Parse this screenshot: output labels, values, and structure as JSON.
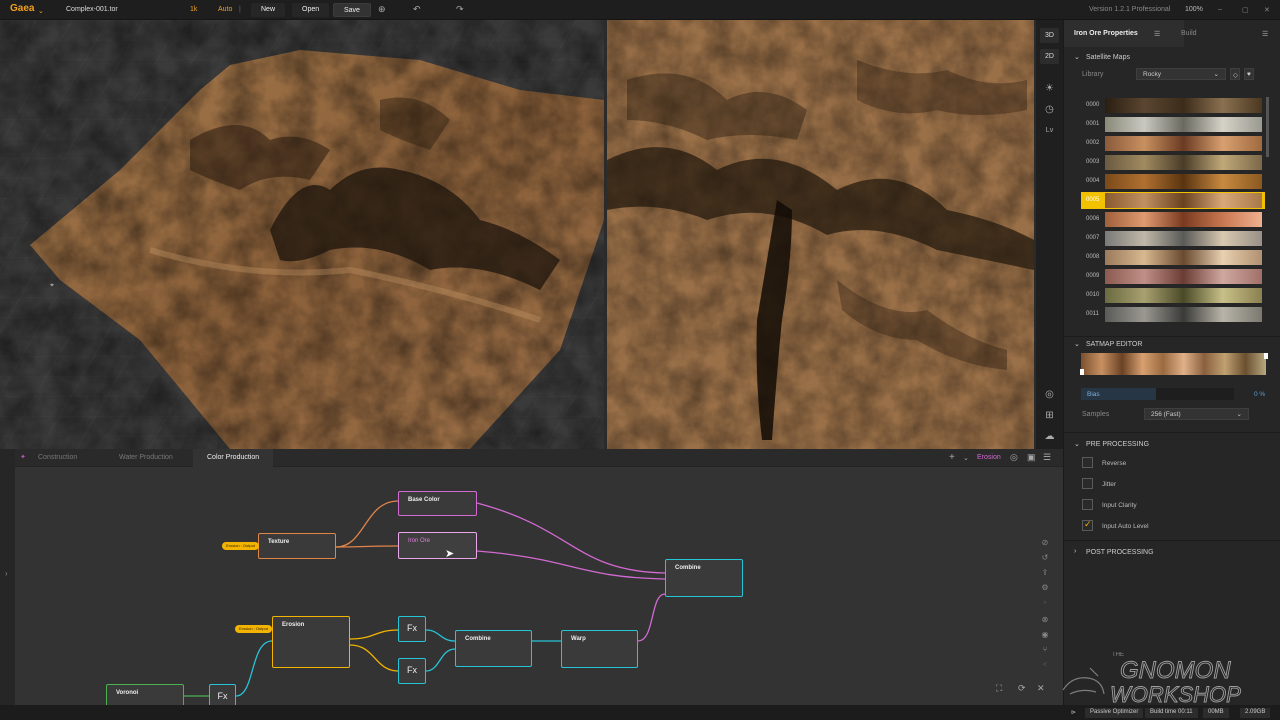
{
  "app": {
    "logo": "Gaea",
    "file_name": "Complex-001.tor",
    "resolution": "1k",
    "auto": "Auto",
    "new_label": "New",
    "open_label": "Open",
    "save_label": "Save",
    "version": "Version 1.2.1 Professional",
    "zoom": "100%"
  },
  "view_toolbar": {
    "btn_3d": "3D",
    "btn_2d": "2D",
    "lv": "Lv"
  },
  "right_panel": {
    "tab_properties": "Iron Ore Properties",
    "tab_build": "Build",
    "section_satmaps": "Satellite Maps",
    "library_label": "Library",
    "library_value": "Rocky",
    "swatches": [
      {
        "id": "0000",
        "colors": [
          "#2a1e12",
          "#5a4630",
          "#3c2c1a",
          "#8a7050",
          "#4a3820"
        ]
      },
      {
        "id": "0001",
        "colors": [
          "#8a8a7a",
          "#c8c8c0",
          "#6a6a60",
          "#d6d2c8",
          "#9a9a90"
        ]
      },
      {
        "id": "0002",
        "colors": [
          "#8a5a3a",
          "#c89060",
          "#6a3a22",
          "#d8a070",
          "#a06a40"
        ]
      },
      {
        "id": "0003",
        "colors": [
          "#6a5a40",
          "#a08a60",
          "#4a3c28",
          "#c0a878",
          "#7a6848"
        ]
      },
      {
        "id": "0004",
        "colors": [
          "#7a4a1a",
          "#b07030",
          "#5a3410",
          "#c88a40",
          "#8a5820"
        ]
      },
      {
        "id": "0005",
        "colors": [
          "#8a5a30",
          "#c09060",
          "#6a4220",
          "#d8a878",
          "#a87848"
        ]
      },
      {
        "id": "0006",
        "colors": [
          "#a0603a",
          "#e09a70",
          "#7a3a20",
          "#c87850",
          "#f0b090"
        ]
      },
      {
        "id": "0007",
        "colors": [
          "#7a7a78",
          "#c0b8a8",
          "#5a5a58",
          "#d8c8b0",
          "#9a9088"
        ]
      },
      {
        "id": "0008",
        "colors": [
          "#9a7a5a",
          "#d8b890",
          "#6a4a30",
          "#e8d0b0",
          "#b09070"
        ]
      },
      {
        "id": "0009",
        "colors": [
          "#8a5a50",
          "#c09088",
          "#6a3c34",
          "#d0a8a0",
          "#a07068"
        ]
      },
      {
        "id": "0010",
        "colors": [
          "#6a6a40",
          "#a8a070",
          "#4a4a28",
          "#c8c088",
          "#8a8050"
        ]
      },
      {
        "id": "0011",
        "colors": [
          "#5a5a58",
          "#9a9890",
          "#3a3a38",
          "#b8b4a8",
          "#7a7870"
        ]
      }
    ],
    "selected_swatch": "0005",
    "section_satmap_editor": "SATMAP EDITOR",
    "bias_label": "Bias",
    "bias_value": "0 %",
    "samples_label": "Samples",
    "samples_value": "256 (Fast)",
    "section_pre": "PRE PROCESSING",
    "checks": [
      {
        "label": "Reverse",
        "checked": false
      },
      {
        "label": "Jitter",
        "checked": false
      },
      {
        "label": "Input Clarity",
        "checked": false
      },
      {
        "label": "Input Auto Level",
        "checked": true
      }
    ],
    "section_post": "POST PROCESSING"
  },
  "graph": {
    "tabs": [
      "Construction",
      "Water Production",
      "Color Production"
    ],
    "active_tab": "Color Production",
    "right_label": "Erosion",
    "nodes": {
      "base_color": "Base Color",
      "iron_ore": "Iron Ore",
      "texture": "Texture",
      "combine_top": "Combine",
      "erosion": "Erosion",
      "fx1": "Fx",
      "fx2": "Fx",
      "fx3": "Fx",
      "combine_mid": "Combine",
      "warp": "Warp",
      "voronoi": "Voronoi"
    },
    "pill_texture": "Erosion : Output",
    "pill_erosion": "Erosion : Output"
  },
  "status": {
    "passive_optimizer": "Passive Optimizer",
    "build_time": "Build time 00:11",
    "mem": "00MB",
    "gpu": "2.09GB"
  },
  "watermark": {
    "line1": "GNOMON",
    "line2": "WORKSHOP",
    "the": "THE"
  },
  "colors": {
    "accent": "#f0a020",
    "node_pink": "#d26ad2",
    "node_cyan": "#27c4d8",
    "node_orange": "#e0844a",
    "node_yellow": "#f2b400",
    "node_green": "#4caf50"
  }
}
